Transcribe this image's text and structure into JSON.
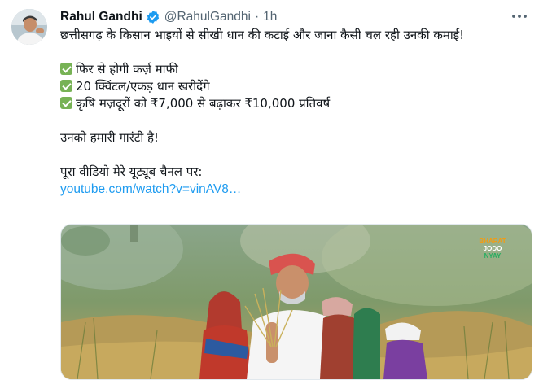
{
  "tweet": {
    "author_name": "Rahul Gandhi",
    "handle": "@RahulGandhi",
    "separator": "·",
    "time": "1h",
    "more_icon": "more-horizontal-icon",
    "verified_icon": "verified-badge-icon",
    "lines": [
      "छत्तीसगढ़ के किसान भाइयों से सीखी धान की कटाई और जाना कैसी चल रही उनकी कमाई!",
      "फिर से होगी कर्ज़ माफी",
      "20 क्विंटल/एकड़ धान खरीदेंगे",
      "कृषि मज़दूरों को ₹7,000 से बढ़ाकर ₹10,000 प्रतिवर्ष",
      "उनको हमारी गारंटी है!",
      "पूरा वीडियो मेरे यूट्यूब चैनल पर:"
    ],
    "link_text": "youtube.com/watch?v=vinAV8…",
    "media": {
      "logo_lines": [
        "BHARAT",
        "JODO",
        "NYAY"
      ]
    }
  },
  "colors": {
    "link": "#1d9bf0",
    "secondary_text": "#536471",
    "verified": "#1d9bf0",
    "check_emoji": "#77b255"
  }
}
